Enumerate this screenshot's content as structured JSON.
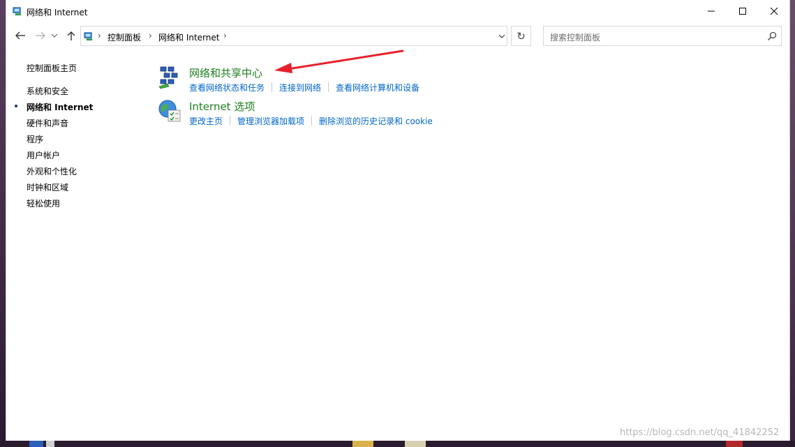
{
  "window": {
    "title": "网络和 Internet"
  },
  "address": {
    "crumbs": [
      "控制面板",
      "网络和 Internet"
    ]
  },
  "search": {
    "placeholder": "搜索控制面板"
  },
  "leftnav": {
    "home": "控制面板主页",
    "items": [
      {
        "label": "系统和安全",
        "active": false
      },
      {
        "label": "网络和 Internet",
        "active": true
      },
      {
        "label": "硬件和声音",
        "active": false
      },
      {
        "label": "程序",
        "active": false
      },
      {
        "label": "用户帐户",
        "active": false
      },
      {
        "label": "外观和个性化",
        "active": false
      },
      {
        "label": "时钟和区域",
        "active": false
      },
      {
        "label": "轻松使用",
        "active": false
      }
    ]
  },
  "categories": [
    {
      "title": "网络和共享中心",
      "icon": "network-sharing-icon",
      "links": [
        "查看网络状态和任务",
        "连接到网络",
        "查看网络计算机和设备"
      ]
    },
    {
      "title": "Internet 选项",
      "icon": "internet-options-icon",
      "links": [
        "更改主页",
        "管理浏览器加载项",
        "删除浏览的历史记录和 cookie"
      ]
    }
  ],
  "colors": {
    "category_title": "#1e7f1e",
    "link": "#0066cc",
    "annotation_arrow": "#e8212b"
  },
  "watermark": "https://blog.csdn.net/qq_41842252"
}
